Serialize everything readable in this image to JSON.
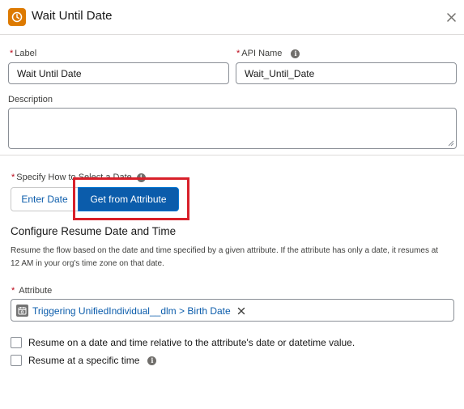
{
  "header": {
    "title": "Wait Until Date",
    "icon": "clock-icon",
    "icon_color": "#dd7a01"
  },
  "label_field": {
    "required_marker": "*",
    "label": "Label",
    "value": "Wait Until Date"
  },
  "api_name_field": {
    "required_marker": "*",
    "label": "API Name",
    "value": "Wait_Until_Date"
  },
  "description_field": {
    "label": "Description",
    "value": ""
  },
  "date_selection": {
    "required_marker": "*",
    "label": "Specify How to Select a Date",
    "options": [
      "Enter Date",
      "Get from Attribute"
    ],
    "selected": "Get from Attribute",
    "highlight_color": "#d8202a"
  },
  "resume_section": {
    "title": "Configure Resume Date and Time",
    "help_text": "Resume the flow based on the date and time specified by a given attribute. If the attribute has only a date, it resumes at 12 AM in your org's time zone on that date."
  },
  "attribute_field": {
    "required_marker": "*",
    "label": "Attribute",
    "selected_value": "Triggering UnifiedIndividual__dlm > Birth Date",
    "value_icon": "calendar-icon"
  },
  "options": [
    {
      "label": "Resume on a date and time relative to the attribute's date or datetime value.",
      "checked": false
    },
    {
      "label": "Resume at a specific time",
      "checked": false
    }
  ],
  "colors": {
    "brand": "#0b5cab",
    "required": "#ba0517",
    "border": "#8a8f96"
  }
}
